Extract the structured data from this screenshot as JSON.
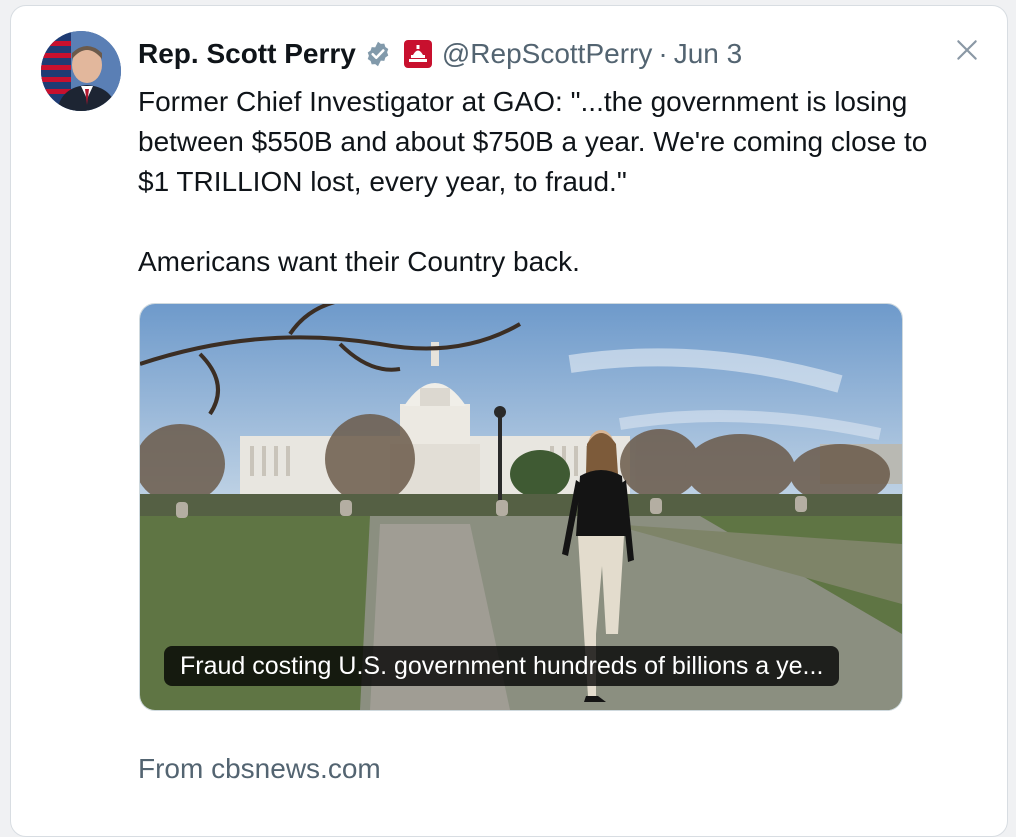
{
  "tweet": {
    "author_name": "Rep. Scott Perry",
    "handle": "@RepScottPerry",
    "separator": "·",
    "date": "Jun 3",
    "text": "Former Chief Investigator at GAO: \"...the government is losing between $550B and about $750B a year. We're coming close to $1 TRILLION lost, every year, to fraud.\"\n\nAmericans want their Country back.",
    "verified_icon": "verified-badge-icon",
    "affiliation_icon": "capitol-affiliation-icon",
    "close_icon": "close-icon"
  },
  "card": {
    "caption": "Fraud costing U.S. government hundreds of billions a ye...",
    "source": "From cbsnews.com"
  },
  "colors": {
    "text": "#0f1419",
    "secondary": "#536471",
    "verified": "#829aab",
    "affiliation": "#c8102e"
  }
}
